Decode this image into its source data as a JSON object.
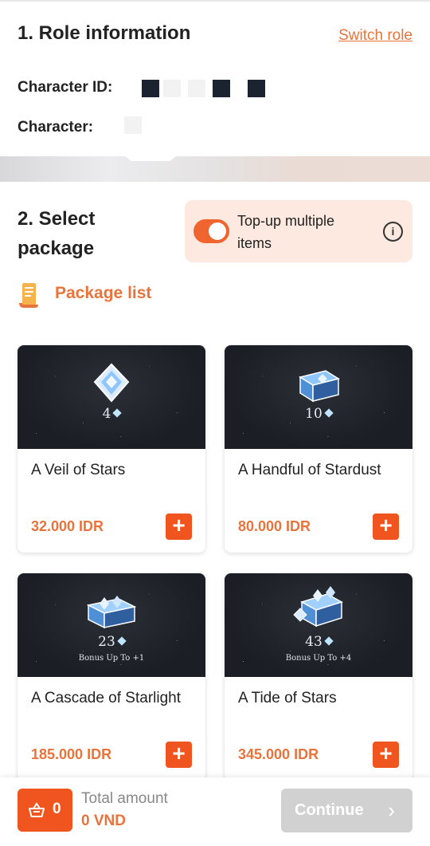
{
  "role": {
    "title": "1. Role information",
    "switch_label": "Switch role",
    "character_id_label": "Character ID:",
    "character_label": "Character:"
  },
  "package": {
    "title_line1": "2. Select",
    "title_line2": "package",
    "multi_label": "Top-up multiple items",
    "multi_enabled": true,
    "list_label": "Package list"
  },
  "packages": [
    {
      "name": "A Veil of Stars",
      "price": "32.000 IDR",
      "qty": "4",
      "bonus": ""
    },
    {
      "name": "A Handful of Stardust",
      "price": "80.000 IDR",
      "qty": "10",
      "bonus": ""
    },
    {
      "name": "A Cascade of Starlight",
      "price": "185.000 IDR",
      "qty": "23",
      "bonus": "Bonus Up To  +1"
    },
    {
      "name": "A Tide of Stars",
      "price": "345.000 IDR",
      "qty": "43",
      "bonus": "Bonus Up To  +4"
    }
  ],
  "footer": {
    "cart_count": "0",
    "total_label": "Total amount",
    "total_value": "0 VND",
    "continue_label": "Continue"
  },
  "colors": {
    "accent": "#e8743c",
    "button": "#f0551f",
    "disabled": "#d1d1d1"
  },
  "icons": {
    "add": "plus-icon",
    "cart": "basket-icon",
    "info": "info-icon",
    "list": "scroll-icon",
    "next": "chevron-right-icon"
  }
}
